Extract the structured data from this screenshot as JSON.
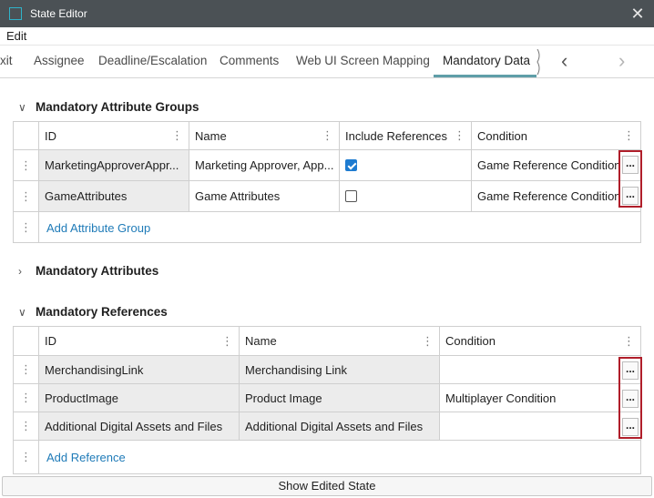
{
  "window": {
    "title": "State Editor",
    "close_glyph": "✕"
  },
  "menu": {
    "edit": "Edit"
  },
  "tabs": [
    {
      "label": "Exit"
    },
    {
      "label": "Assignee"
    },
    {
      "label": "Deadline/Escalation"
    },
    {
      "label": "Comments"
    },
    {
      "label": "Web UI Screen Mapping"
    },
    {
      "label": "Mandatory Data",
      "active": true
    }
  ],
  "tab_nav": {
    "prev_glyph": "‹",
    "next_glyph": "›"
  },
  "sections": {
    "groups": {
      "title": "Mandatory Attribute Groups",
      "expanded": true,
      "columns": [
        "ID",
        "Name",
        "Include References",
        "Condition"
      ],
      "rows": [
        {
          "id": "MarketingApproverAppr...",
          "name": "Marketing Approver, App...",
          "include_references": true,
          "condition": "Game Reference Condition"
        },
        {
          "id": "GameAttributes",
          "name": "Game Attributes",
          "include_references": false,
          "condition": "Game Reference Condition"
        }
      ],
      "add_label": "Add Attribute Group"
    },
    "attributes": {
      "title": "Mandatory Attributes",
      "expanded": false
    },
    "references": {
      "title": "Mandatory References",
      "expanded": true,
      "columns": [
        "ID",
        "Name",
        "Condition"
      ],
      "rows": [
        {
          "id": "MerchandisingLink",
          "name": "Merchandising Link",
          "condition": ""
        },
        {
          "id": "ProductImage",
          "name": "Product Image",
          "condition": "Multiplayer Condition"
        },
        {
          "id": "Additional Digital Assets and Files",
          "name": "Additional Digital Assets and Files",
          "condition": ""
        }
      ],
      "add_label": "Add Reference"
    }
  },
  "glyphs": {
    "ellipsis": "...",
    "drag": "⋮",
    "col_menu": "⋮",
    "expanded": "∨",
    "collapsed": "›"
  },
  "footer": {
    "button_label": "Show Edited State"
  },
  "colors": {
    "accent": "#5f9ea8",
    "link": "#1f7bb8",
    "highlight": "#b01e2a",
    "checkbox": "#1e7bd0",
    "titlebar": "#4b5155"
  }
}
